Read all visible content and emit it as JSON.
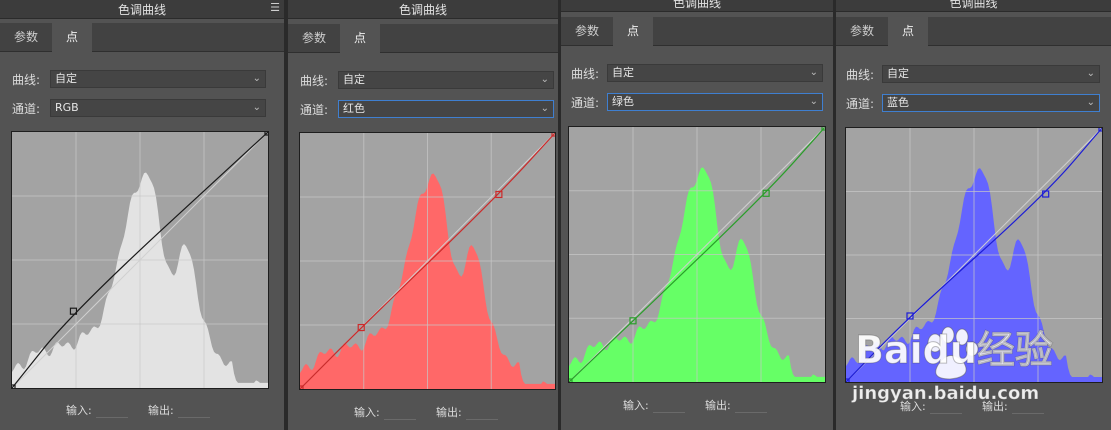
{
  "panel_title": "色调曲线",
  "tabs": [
    "参数",
    "点"
  ],
  "curve_label": "曲线:",
  "curve_value": "自定",
  "channel_label": "通道:",
  "input_label": "输入:",
  "output_label": "输出:",
  "panels": [
    {
      "channel_value": "RGB",
      "color": "#e3e3e3",
      "line": "#1a1a1a",
      "handles": [
        [
          0,
          0
        ],
        [
          0.24,
          0.3
        ],
        [
          1,
          1
        ]
      ]
    },
    {
      "channel_value": "红色",
      "color": "#ff6868",
      "line": "#cc2a2a",
      "handles": [
        [
          0,
          0
        ],
        [
          0.24,
          0.24
        ],
        [
          0.78,
          0.76
        ],
        [
          1,
          1
        ]
      ]
    },
    {
      "channel_value": "绿色",
      "color": "#66ff66",
      "line": "#2a9e2a",
      "handles": [
        [
          0,
          0
        ],
        [
          0.25,
          0.24
        ],
        [
          0.77,
          0.74
        ],
        [
          1,
          1
        ]
      ]
    },
    {
      "channel_value": "蓝色",
      "color": "#6464ff",
      "line": "#1c1cd6",
      "handles": [
        [
          0,
          0
        ],
        [
          0.25,
          0.26
        ],
        [
          0.78,
          0.74
        ],
        [
          1,
          1
        ]
      ]
    }
  ],
  "watermark": {
    "brand": "Baidu经验",
    "url": "jingyan.baidu.com"
  }
}
